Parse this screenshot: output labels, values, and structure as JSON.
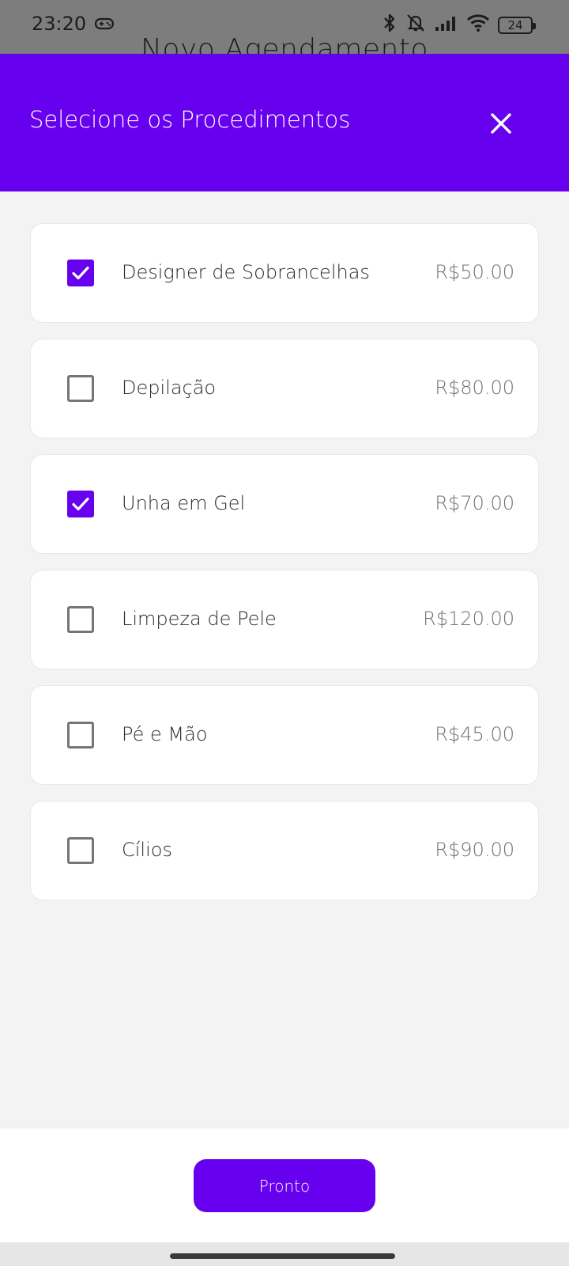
{
  "status_bar": {
    "time": "23:20",
    "battery": "24",
    "icons": [
      "gamepad-icon",
      "bluetooth-icon",
      "mute-notification-icon",
      "signal-icon",
      "wifi-icon",
      "battery-icon"
    ]
  },
  "background_screen": {
    "title": "Novo Agendamento"
  },
  "dialog": {
    "title": "Selecione os Procedimentos",
    "close_icon": "close-icon",
    "items": [
      {
        "label": "Designer de Sobrancelhas",
        "price": "R$50.00",
        "checked": true
      },
      {
        "label": "Depilação",
        "price": "R$80.00",
        "checked": false
      },
      {
        "label": "Unha em Gel",
        "price": "R$70.00",
        "checked": true
      },
      {
        "label": "Limpeza de Pele",
        "price": "R$120.00",
        "checked": false
      },
      {
        "label": "Pé e Mão",
        "price": "R$45.00",
        "checked": false
      },
      {
        "label": "Cílios",
        "price": "R$90.00",
        "checked": false
      }
    ],
    "done_label": "Pronto"
  },
  "colors": {
    "accent": "#6600ee",
    "background": "#f3f3f3",
    "card": "#ffffff",
    "scrim": "#7d7d7d"
  }
}
